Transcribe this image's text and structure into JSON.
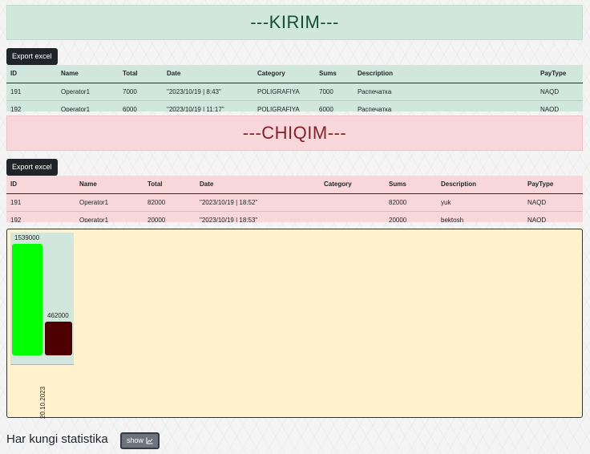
{
  "kirim": {
    "title": "---KIRIM---",
    "export_label": "Export excel",
    "columns": [
      "ID",
      "Name",
      "Total",
      "Date",
      "Category",
      "Sums",
      "Description",
      "PayType"
    ],
    "rows": [
      [
        "191",
        "Operator1",
        "7000",
        "\"2023/10/19 | 8:43\"",
        "POLIGRAFIYA",
        "7000",
        "Распечатка",
        "NAQD"
      ],
      [
        "192",
        "Operator1",
        "6000",
        "\"2023/10/19 | 11:17\"",
        "POLIGRAFIYA",
        "6000",
        "Распечатка",
        "NAQD"
      ]
    ]
  },
  "chiqim": {
    "title": "---CHIQIM---",
    "export_label": "Export excel",
    "columns": [
      "ID",
      "Name",
      "Total",
      "Date",
      "Category",
      "Sums",
      "Description",
      "PayType"
    ],
    "rows": [
      [
        "191",
        "Operator1",
        "82000",
        "\"2023/10/19 | 18:52\"",
        "",
        "82000",
        "yuk",
        "NAQD"
      ],
      [
        "192",
        "Operator1",
        "20000",
        "\"2023/10/19 | 18:53\"",
        "",
        "20000",
        "bektosh",
        "NAQD"
      ]
    ]
  },
  "chart_data": {
    "type": "bar",
    "categories": [
      "20.10.2023"
    ],
    "series": [
      {
        "values": [
          1539000
        ],
        "color": "#00ff00"
      },
      {
        "values": [
          462000
        ],
        "color": "#4d0000"
      }
    ],
    "ylim": [
      0,
      1539000
    ]
  },
  "footer": {
    "title": "Har kungi statistika",
    "show_label": "show",
    "show_icon": "chart-icon"
  }
}
